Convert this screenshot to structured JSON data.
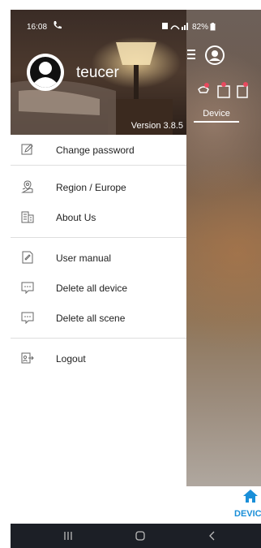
{
  "status_bar": {
    "time": "16:08",
    "battery_percent": "82%"
  },
  "profile": {
    "username": "teucer",
    "version": "Version 3.8.5"
  },
  "menu": {
    "group1": [
      {
        "label": "Change password",
        "icon": "edit-icon"
      }
    ],
    "group2": [
      {
        "label": "Region / Europe",
        "icon": "map-pin-icon"
      },
      {
        "label": "About Us",
        "icon": "building-icon"
      }
    ],
    "group3": [
      {
        "label": "User manual",
        "icon": "document-icon"
      },
      {
        "label": "Delete all device",
        "icon": "message-dots-icon"
      },
      {
        "label": "Delete all scene",
        "icon": "message-dots-icon"
      }
    ],
    "group4": [
      {
        "label": "Logout",
        "icon": "logout-icon"
      }
    ]
  },
  "background_app": {
    "tab_label": "Device",
    "bottom_tab_label": "DEVIC"
  },
  "colors": {
    "accent": "#1a8fd8",
    "drawer_bg": "#ffffff",
    "navbar_bg": "#1c1f26"
  }
}
